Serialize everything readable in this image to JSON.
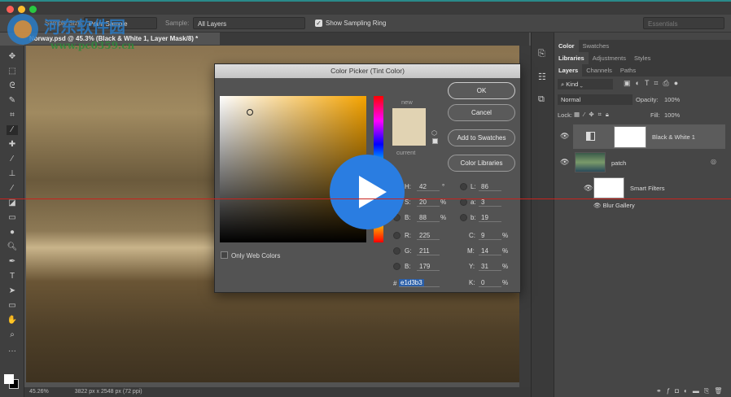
{
  "titlebar": {
    "workspace": "Essentials"
  },
  "options": {
    "sample_size_label": "Sample Size:",
    "sample_size_value": "Point Sample",
    "sample_label": "Sample:",
    "sample_value": "All Layers",
    "sampling_ring_label": "Show Sampling Ring"
  },
  "document": {
    "tab": "Norway.psd @ 45.3% (Black & White 1, Layer Mask/8) *"
  },
  "status": {
    "zoom": "45.26%",
    "dimensions": "3822 px x 2548 px (72 ppi)"
  },
  "panels": {
    "tabs1": [
      "Color",
      "Swatches"
    ],
    "tabs2": [
      "Libraries",
      "Adjustments",
      "Styles"
    ],
    "tabs3": [
      "Layers",
      "Channels",
      "Paths"
    ],
    "kind": "Kind",
    "blend": "Normal",
    "opacity_label": "Opacity:",
    "opacity": "100%",
    "lock_label": "Lock:",
    "fill_label": "Fill:",
    "fill": "100%",
    "layers": [
      {
        "name": "Black & White 1"
      },
      {
        "name": "patch"
      },
      {
        "name": "Smart Filters"
      },
      {
        "name": "Blur Gallery"
      }
    ]
  },
  "dialog": {
    "title": "Color Picker (Tint Color)",
    "new_label": "new",
    "current_label": "current",
    "ok": "OK",
    "cancel": "Cancel",
    "add_swatches": "Add to Swatches",
    "color_libraries": "Color Libraries",
    "web_colors": "Only Web Colors",
    "new_color": "#e1d3b3",
    "current_color": "#e1d3b3",
    "H": "42",
    "S": "20",
    "B": "88",
    "R": "225",
    "G": "211",
    "Bl": "179",
    "L": "86",
    "a": "3",
    "b": "19",
    "C": "9",
    "M": "14",
    "Y": "31",
    "K": "0",
    "hex": "e1d3b3",
    "deg": "°",
    "pct": "%"
  },
  "watermark": {
    "text": "河东软件园",
    "url": "www.pc0359.cn"
  }
}
